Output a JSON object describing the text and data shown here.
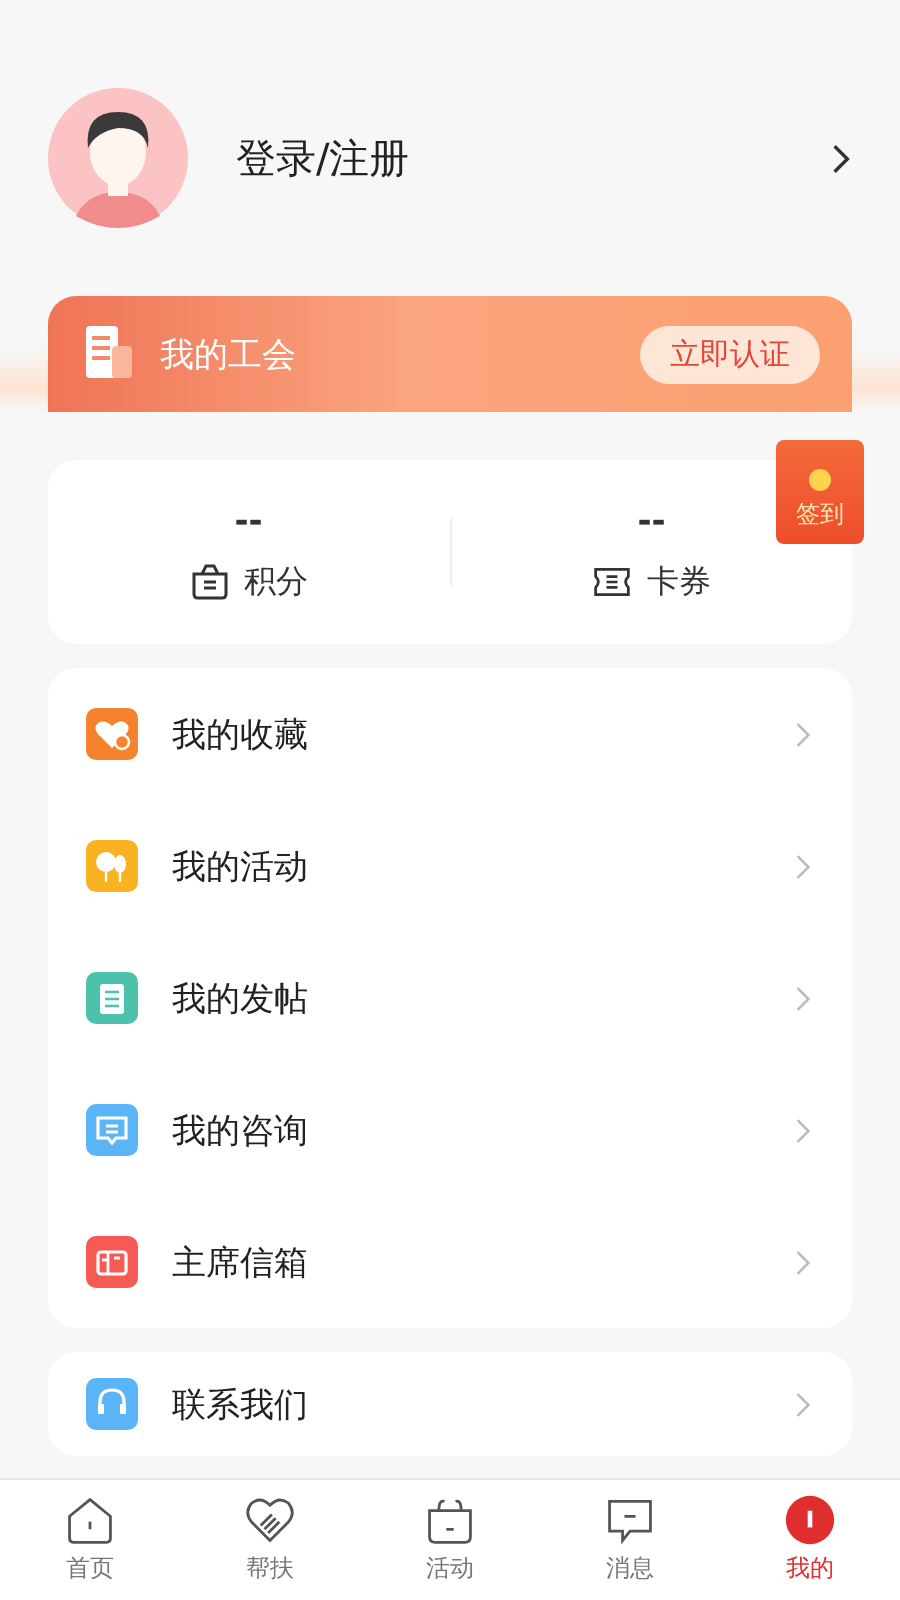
{
  "profile": {
    "login": "登录/注册"
  },
  "union": {
    "title": "我的工会",
    "action": "立即认证"
  },
  "stats": [
    {
      "value": "--",
      "label": "积分"
    },
    {
      "value": "--",
      "label": "卡券"
    }
  ],
  "checkin": {
    "label": "签到"
  },
  "menu": [
    {
      "label": "我的收藏",
      "color": "#f5822d"
    },
    {
      "label": "我的活动",
      "color": "#fbb222"
    },
    {
      "label": "我的发帖",
      "color": "#4cc2ad"
    },
    {
      "label": "我的咨询",
      "color": "#5ab4f8"
    },
    {
      "label": "主席信箱",
      "color": "#f75a55"
    }
  ],
  "contact": {
    "label": "联系我们",
    "color": "#5ab4f8"
  },
  "tabs": [
    {
      "label": "首页",
      "selected": false
    },
    {
      "label": "帮扶",
      "selected": false
    },
    {
      "label": "活动",
      "selected": false
    },
    {
      "label": "消息",
      "selected": false
    },
    {
      "label": "我的",
      "selected": true
    }
  ]
}
